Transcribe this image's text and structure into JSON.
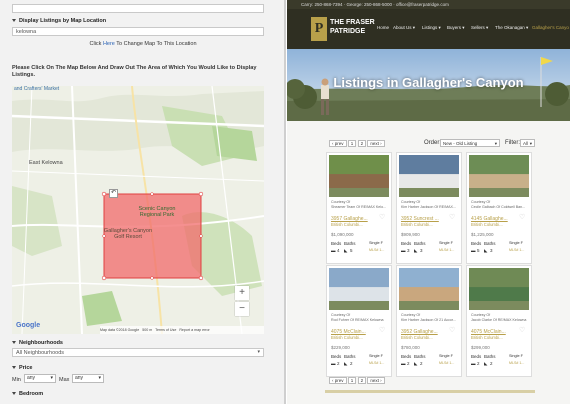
{
  "left": {
    "location_header": "Display Listings by Map Location",
    "location_value": "kelowna",
    "click_here": "Click",
    "here_link": "Here",
    "change_map_text": "To Change Map To This Location",
    "instructions": "Please Click On The Map Below And Draw Out The Area of Which You Would Like to Display Listings.",
    "map": {
      "labels": {
        "crafters": "and Crafters' Market",
        "east_kelowna": "East Kelowna",
        "scenic_canyon": "Scenic Canyon Regional Park",
        "gallaghers": "Gallagher's Canyon Golf Resort",
        "google": "Google",
        "attribution": "Map data ©2018 Google",
        "scale": "500 m",
        "terms": "Terms of Use",
        "report": "Report a map error"
      },
      "zoom_in": "+",
      "zoom_out": "−",
      "polygon_color": "#f26b6b"
    },
    "neighbourhoods_header": "Neighbourhoods",
    "neighbourhoods_value": "All Neighbourhoods",
    "price_header": "Price",
    "min_label": "Min",
    "min_value": "any",
    "max_label": "Max",
    "max_value": "any",
    "bedroom_header": "Bedroom"
  },
  "right": {
    "topbar": "Carry: 250-868-7394 · George: 250-868-5000 · office@fraserpatridge.com",
    "logo_top": "THE FRASER",
    "logo_bottom": "PATRIDGE",
    "logo_letter": "P",
    "nav": [
      "Home",
      "About Us ▾",
      "Listings ▾",
      "Buyers ▾",
      "Sellers ▾",
      "The Okanagan ▾",
      "Gallagher's Canyo"
    ],
    "hero_title": "Listings in Gallagher's Canyon",
    "prev_label": "‹ prev",
    "page_1": "1",
    "page_2": "2",
    "next_label": "next ›",
    "order_label": "Order:",
    "order_value": "New - Old Listing",
    "filter_label": "Filter:",
    "filter_value": "All",
    "accent": "#b8a04a",
    "cards": [
      {
        "courtesy": "Courtesy Of",
        "office": "Sheamer Team Of RE/MAX Kelo...",
        "name": "3957 Gallaghe...",
        "city": "British Columbi...",
        "price": "$1,090,000",
        "beds": "4",
        "baths": "5",
        "type": "Single F",
        "id": "MLS# 1..."
      },
      {
        "courtesy": "Courtesy Of",
        "office": "Kim Harber Jackson Of RE/MAX...",
        "name": "3952 Suncrest ...",
        "city": "British Columbi...",
        "price": "$909,900",
        "beds": "3",
        "baths": "3",
        "type": "Single F",
        "id": "MLS# 1..."
      },
      {
        "courtesy": "Courtesy Of",
        "office": "Cecile Galbach Of Coldwell Ban...",
        "name": "4145 Gallaghe...",
        "city": "British Columbi...",
        "price": "$1,225,000",
        "beds": "5",
        "baths": "3",
        "type": "Single F",
        "id": "MLS# 1..."
      },
      {
        "courtesy": "Courtesy Of",
        "office": "Rod Fuhrer Of RE/MAX Kelowna",
        "name": "4075 McClain...",
        "city": "British Columbi...",
        "price": "$229,000",
        "beds": "2",
        "baths": "2",
        "type": "Single F",
        "id": "MLS# 1..."
      },
      {
        "courtesy": "Courtesy Of",
        "office": "Kim Harber Jackson Of 21 Accor...",
        "name": "3952 Gallaghe...",
        "city": "British Columbi...",
        "price": "$780,000",
        "beds": "2",
        "baths": "2",
        "type": "Single F",
        "id": "MLS# 1..."
      },
      {
        "courtesy": "Courtesy Of",
        "office": "Jacob Clarke Of RE/MAX Kelowna",
        "name": "4075 McClain...",
        "city": "British Columbi...",
        "price": "$299,000",
        "beds": "2",
        "baths": "2",
        "type": "Single F",
        "id": "MLS# 1..."
      }
    ],
    "card_labels": {
      "beds": "Beds",
      "baths": "Baths"
    }
  }
}
